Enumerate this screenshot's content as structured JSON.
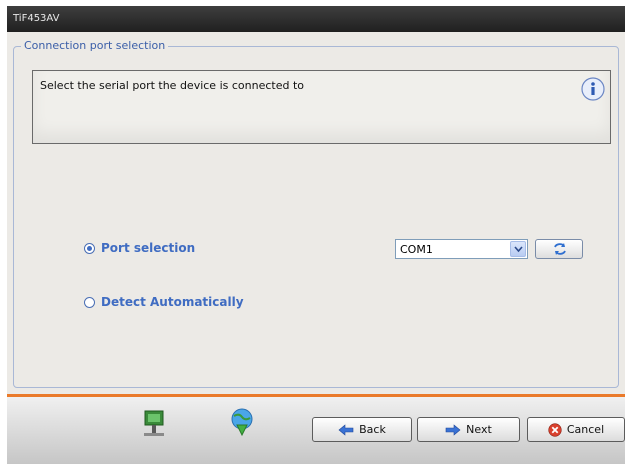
{
  "window": {
    "title": "TiF453AV"
  },
  "group": {
    "legend": "Connection port selection"
  },
  "info": {
    "text": "Select the serial port the device is connected to",
    "icon": "info-icon"
  },
  "options": {
    "port_selection": {
      "label": "Port selection",
      "checked": true
    },
    "detect_auto": {
      "label": "Detect Automatically",
      "checked": false
    }
  },
  "port_combo": {
    "value": "COM1"
  },
  "footer": {
    "back_label": "Back",
    "next_label": "Next",
    "cancel_label": "Cancel"
  },
  "colors": {
    "accent": "#3f6cc2",
    "divider": "#ea7a2a",
    "titlebar": "#2a2a2a"
  }
}
